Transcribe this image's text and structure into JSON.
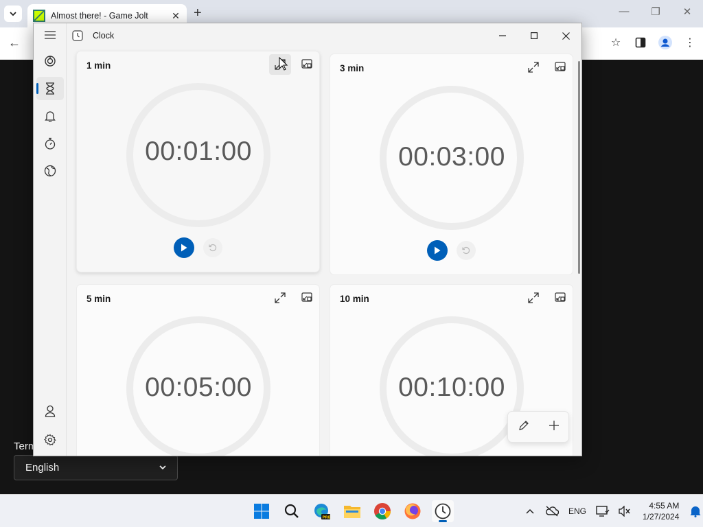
{
  "browser": {
    "tab_title": "Almost there! - Game Jolt",
    "terms_text": "Term",
    "language_selected": "English"
  },
  "clock_app": {
    "title": "Clock",
    "timers": [
      {
        "label": "1 min",
        "time": "00:01:00"
      },
      {
        "label": "3 min",
        "time": "00:03:00"
      },
      {
        "label": "5 min",
        "time": "00:05:00"
      },
      {
        "label": "10 min",
        "time": "00:10:00"
      }
    ],
    "nav_icons": [
      "focus-icon",
      "timer-icon",
      "alarm-icon",
      "stopwatch-icon",
      "world-clock-icon",
      "account-icon",
      "settings-icon"
    ]
  },
  "taskbar": {
    "language": "ENG",
    "time": "4:55 AM",
    "date": "1/27/2024"
  },
  "colors": {
    "accent": "#005fb8",
    "timer_text": "#5a5a5a",
    "ring": "#ececec"
  }
}
